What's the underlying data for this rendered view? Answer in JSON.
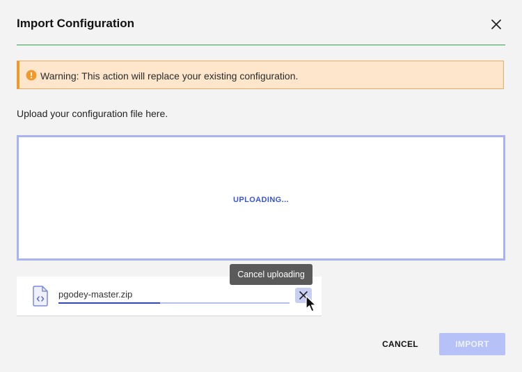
{
  "dialog": {
    "title": "Import Configuration",
    "close_icon": "close-icon"
  },
  "warning": {
    "text": "Warning: This action will replace your existing configuration.",
    "icon": "exclamation-circle-icon",
    "color": "#f2992e"
  },
  "upload": {
    "label": "Upload your configuration file here.",
    "status": "UPLOADING..."
  },
  "file": {
    "name": "pgodey-master.zip",
    "icon": "code-file-icon",
    "progress": 0.44
  },
  "tooltip": {
    "text": "Cancel uploading"
  },
  "actions": {
    "cancel_label": "CANCEL",
    "import_label": "IMPORT"
  },
  "colors": {
    "accent_line": "#2ea84a",
    "primary": "#3048b0",
    "import_disabled": "#b5c1f7"
  }
}
